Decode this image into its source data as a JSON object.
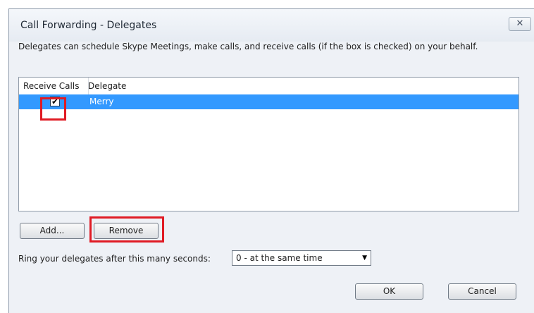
{
  "dialog": {
    "title": "Call Forwarding - Delegates",
    "close_glyph": "✕",
    "description": "Delegates can schedule Skype Meetings, make calls, and receive calls (if the box is checked) on your behalf."
  },
  "delegates_list": {
    "columns": [
      "Receive Calls",
      "Delegate"
    ],
    "rows": [
      {
        "receive_calls": true,
        "check_glyph": "✔",
        "delegate": "Merry",
        "selected": true
      }
    ]
  },
  "buttons": {
    "add": "Add...",
    "remove": "Remove",
    "ok": "OK",
    "cancel": "Cancel"
  },
  "ring": {
    "label": "Ring your delegates after this many seconds:",
    "selected": "0 - at the same time",
    "arrow_glyph": "▼"
  },
  "icons": {
    "close": "close-icon",
    "checkbox_check": "checkmark-icon",
    "dropdown": "chevron-down-icon"
  },
  "colors": {
    "selection": "#3399ff",
    "highlight_annotation": "#e01b24",
    "dialog_background": "#eef1f6"
  }
}
